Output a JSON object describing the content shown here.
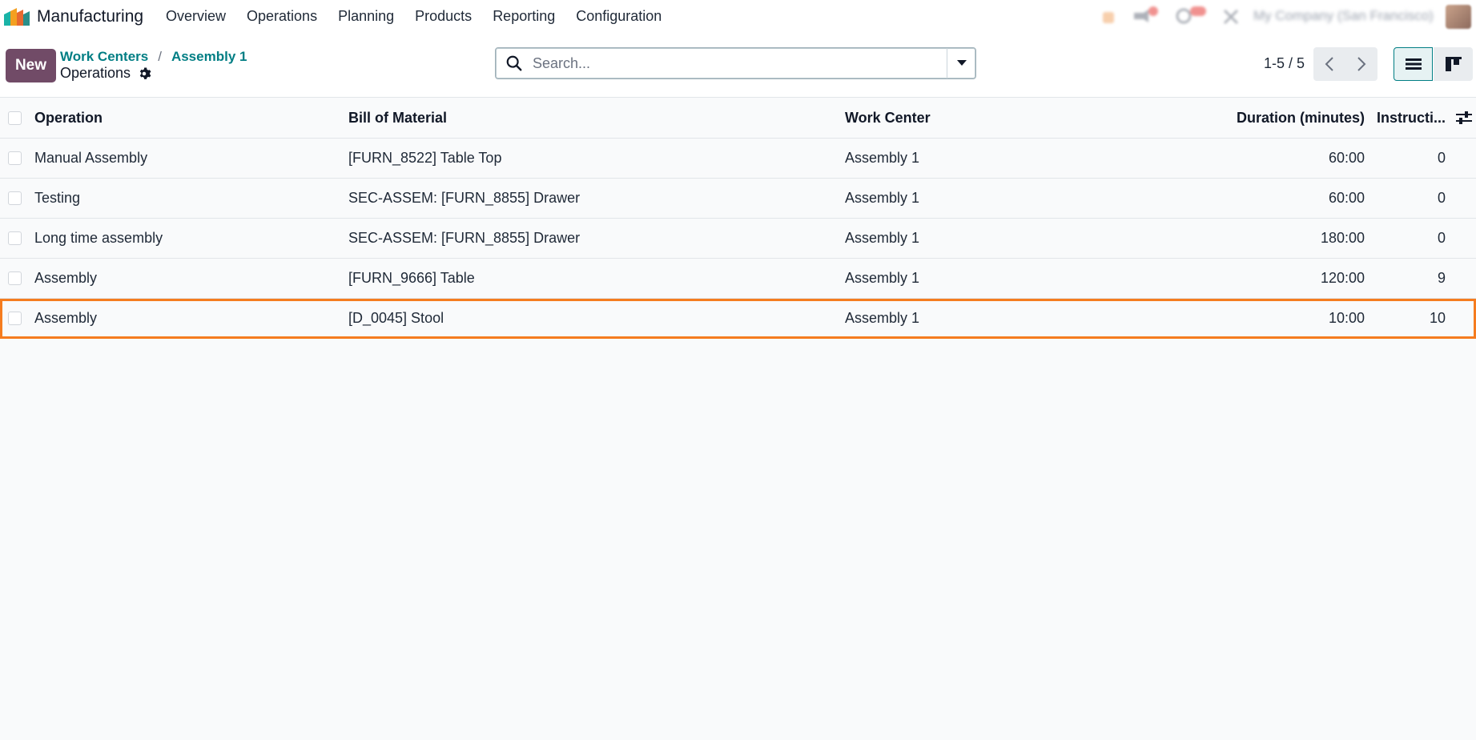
{
  "navbar": {
    "app_name": "Manufacturing",
    "menu": [
      "Overview",
      "Operations",
      "Planning",
      "Products",
      "Reporting",
      "Configuration"
    ],
    "company": "My Company (San Francisco)"
  },
  "control_panel": {
    "new_label": "New",
    "breadcrumb": [
      "Work Centers",
      "Assembly 1"
    ],
    "breadcrumb_separator": "/",
    "title": "Operations",
    "search_placeholder": "Search...",
    "pager": "1-5 / 5"
  },
  "table": {
    "headers": {
      "operation": "Operation",
      "bom": "Bill of Material",
      "work_center": "Work Center",
      "duration": "Duration (minutes)",
      "instructions": "Instructi..."
    },
    "rows": [
      {
        "operation": "Manual Assembly",
        "bom": "[FURN_8522] Table Top",
        "work_center": "Assembly 1",
        "duration": "60:00",
        "instructions": "0"
      },
      {
        "operation": "Testing",
        "bom": "SEC-ASSEM: [FURN_8855] Drawer",
        "work_center": "Assembly 1",
        "duration": "60:00",
        "instructions": "0"
      },
      {
        "operation": "Long time assembly",
        "bom": "SEC-ASSEM: [FURN_8855] Drawer",
        "work_center": "Assembly 1",
        "duration": "180:00",
        "instructions": "0"
      },
      {
        "operation": "Assembly",
        "bom": "[FURN_9666] Table",
        "work_center": "Assembly 1",
        "duration": "120:00",
        "instructions": "9"
      },
      {
        "operation": "Assembly",
        "bom": "[D_0045] Stool",
        "work_center": "Assembly 1",
        "duration": "10:00",
        "instructions": "10"
      }
    ]
  },
  "colors": {
    "brand": "#714b67",
    "link": "#017e84",
    "highlight": "#f57c1f"
  }
}
